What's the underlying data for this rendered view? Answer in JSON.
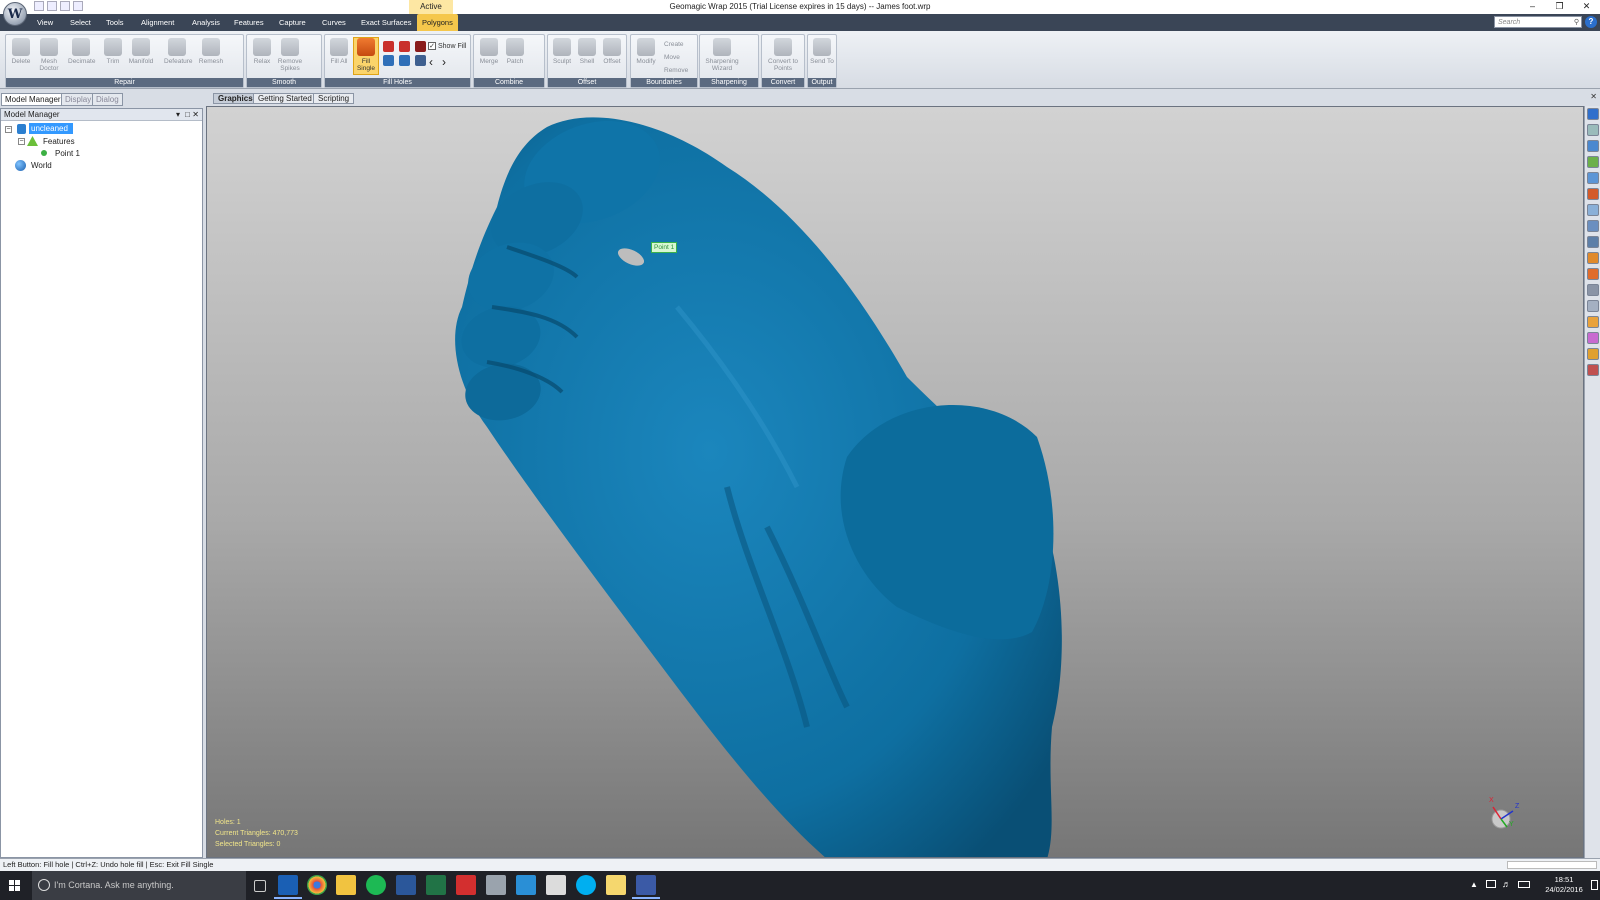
{
  "title_bar": {
    "context_label": "Active",
    "title": "Geomagic Wrap 2015 (Trial License expires in 15 days) -- James foot.wrp",
    "app_letter": "W",
    "controls": [
      "–",
      "❐",
      "✕"
    ]
  },
  "menu": {
    "tabs": [
      "View",
      "Select",
      "Tools",
      "Alignment",
      "Analysis",
      "Features",
      "Capture",
      "Curves",
      "Exact Surfaces",
      "Polygons"
    ],
    "active_tab": "Polygons",
    "search_placeholder": "Search",
    "help": "?"
  },
  "ribbon": {
    "groups": {
      "repair": "Repair",
      "smooth": "Smooth",
      "fill_holes": "Fill Holes",
      "combine": "Combine",
      "offset": "Offset",
      "boundaries": "Boundaries",
      "sharpening": "Sharpening",
      "convert": "Convert",
      "output": "Output"
    },
    "buttons": {
      "delete": "Delete",
      "mesh_doctor": "Mesh Doctor",
      "decimate": "Decimate",
      "trim": "Trim",
      "manifold": "Manifold",
      "defeature": "Defeature",
      "remesh": "Remesh",
      "relax": "Relax",
      "remove_spikes": "Remove Spikes",
      "fill_all": "Fill All",
      "fill_single": "Fill Single",
      "merge": "Merge",
      "patch": "Patch",
      "sculpt": "Sculpt",
      "shell": "Shell",
      "offset": "Offset",
      "modify": "Modify",
      "create": "Create",
      "move": "Move",
      "remove": "Remove",
      "sharpening_wizard": "Sharpening Wizard",
      "convert_to_points": "Convert to Points",
      "send_to": "Send To"
    },
    "show_fill_label": "Show Fill",
    "show_fill_checked": "✓",
    "prev_arrow": "‹",
    "next_arrow": "›"
  },
  "left_panel": {
    "tabs": [
      "Model Manager",
      "Display",
      "Dialog"
    ],
    "active_tab": "Model Manager",
    "header": "Model Manager",
    "header_controls": [
      "▾",
      "□",
      "✕"
    ],
    "tree": {
      "root": "uncleaned",
      "features": "Features",
      "point": "Point 1",
      "world": "World",
      "collapse_symbol": "−"
    }
  },
  "viewport": {
    "tabs": [
      "Graphics",
      "Getting Started",
      "Scripting"
    ],
    "active_tab": "Graphics",
    "point_label": "Point 1",
    "info": {
      "holes": "Holes: 1",
      "current_triangles": "Current Triangles: 470,773",
      "selected_triangles": "Selected Triangles: 0"
    },
    "mesh_color": "#0e6fa1",
    "cap_color": "#0c6c9c",
    "axis": {
      "x": "X",
      "y": "Y",
      "z": "Z"
    },
    "close": "✕"
  },
  "status_bar": {
    "text": "Left Button: Fill hole | Ctrl+Z: Undo hole fill | Esc: Exit Fill Single"
  },
  "taskbar": {
    "search_placeholder": "I'm Cortana. Ask me anything.",
    "time": "18:51",
    "date": "24/02/2016",
    "apps": [
      "task-view-icon",
      "outlook-icon",
      "chrome-icon",
      "file-explorer-icon",
      "spotify-icon",
      "word-icon",
      "excel-icon",
      "acrobat-icon",
      "chess-icon",
      "photos-icon",
      "airplane-icon",
      "skype-icon",
      "folder-icon",
      "geomagic-icon"
    ]
  }
}
